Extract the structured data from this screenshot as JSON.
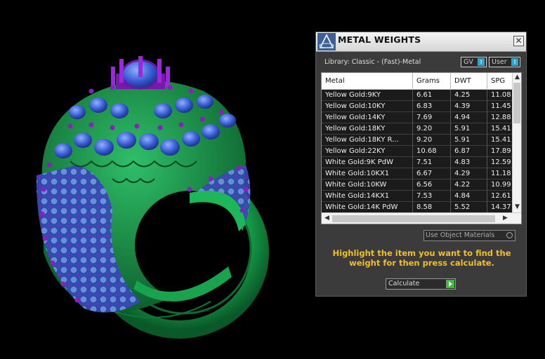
{
  "panel": {
    "title": "METAL WEIGHTS",
    "close_glyph": "✕",
    "library_label": "Library: Classic - (Fast)-Metal",
    "toggles": {
      "gv_label": "GV",
      "user_label": "User",
      "indicator_glyph": "I"
    },
    "table": {
      "columns": [
        "Metal",
        "Grams",
        "DWT",
        "SPG"
      ],
      "rows": [
        [
          "Yellow Gold:9KY",
          "6.61",
          "4.25",
          "11.08"
        ],
        [
          "Yellow Gold:10KY",
          "6.83",
          "4.39",
          "11.45"
        ],
        [
          "Yellow Gold:14KY",
          "7.69",
          "4.94",
          "12.88"
        ],
        [
          "Yellow Gold:18KY",
          "9.20",
          "5.91",
          "15.41"
        ],
        [
          "Yellow Gold:18KY R...",
          "9.20",
          "5.91",
          "15.41"
        ],
        [
          "Yellow Gold:22KY",
          "10.68",
          "6.87",
          "17.89"
        ],
        [
          "White Gold:9K PdW",
          "7.51",
          "4.83",
          "12.59"
        ],
        [
          "White Gold:10KX1",
          "6.67",
          "4.29",
          "11.18"
        ],
        [
          "White Gold:10KW",
          "6.56",
          "4.22",
          "10.99"
        ],
        [
          "White Gold:14KX1",
          "7.53",
          "4.84",
          "12.61"
        ],
        [
          "White Gold:14K PdW",
          "8.58",
          "5.52",
          "14.37"
        ]
      ]
    },
    "use_object_label": "Use Object Materials",
    "instruction": "Highlight the item you want to find the weight for then press calculate.",
    "calculate_label": "Calculate",
    "colors": {
      "accent": "#2fa8cc",
      "instruction": "#f0c020",
      "go": "#3fb83f"
    }
  },
  "viewport": {
    "subject": "ring-model",
    "colors": {
      "metal": "#1fae55",
      "stones": "#3a66d6",
      "prongs": "#8a1fc0"
    }
  }
}
